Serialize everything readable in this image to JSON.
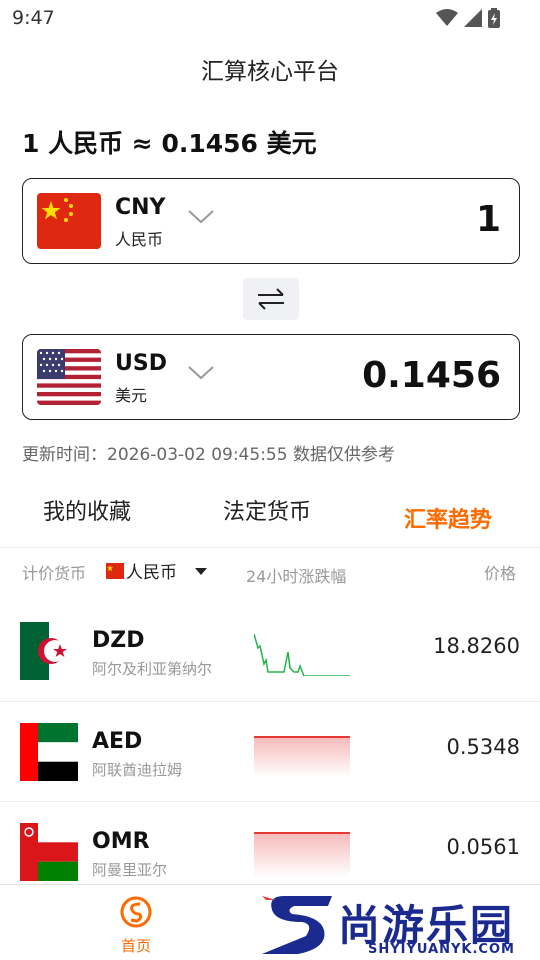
{
  "status_bar": {
    "time": "9:47",
    "icons": [
      "wifi-icon",
      "signal-icon",
      "battery-icon"
    ]
  },
  "header": {
    "title": "汇算核心平台"
  },
  "rate_summary": "1 人民币 ≈ 0.1456 美元",
  "converter": {
    "from": {
      "code": "CNY",
      "name": "人民币",
      "amount": "1",
      "flag": "cn-flag-icon"
    },
    "to": {
      "code": "USD",
      "name": "美元",
      "amount": "0.1456",
      "flag": "us-flag-icon"
    },
    "swap_icon": "swap-icon"
  },
  "update_info": "更新时间：2026-03-02 09:45:55 数据仅供参考",
  "tabs": [
    {
      "label": "我的收藏",
      "active": false
    },
    {
      "label": "法定货币",
      "active": false
    },
    {
      "label": "汇率趋势",
      "active": true
    }
  ],
  "list_header": {
    "base_label": "计价货币",
    "base_currency": "人民币",
    "change_label": "24小时涨跌幅",
    "price_label": "价格"
  },
  "rows": [
    {
      "code": "DZD",
      "name": "阿尔及利亚第纳尔",
      "price": "18.8260",
      "trend": "up",
      "flag": "dz-flag-icon"
    },
    {
      "code": "AED",
      "name": "阿联酋迪拉姆",
      "price": "0.5348",
      "trend": "down",
      "flag": "ae-flag-icon"
    },
    {
      "code": "OMR",
      "name": "阿曼里亚尔",
      "price": "0.0561",
      "trend": "down",
      "flag": "om-flag-icon"
    }
  ],
  "bottom_nav": {
    "home_label": "首页"
  },
  "watermark": {
    "text": "尚游乐园",
    "sub": "SHYIYUANYK.COM"
  },
  "colors": {
    "accent": "#ff6a00",
    "up": "#26b24a",
    "down": "#e53935",
    "watermark": "#1b2a8e"
  }
}
